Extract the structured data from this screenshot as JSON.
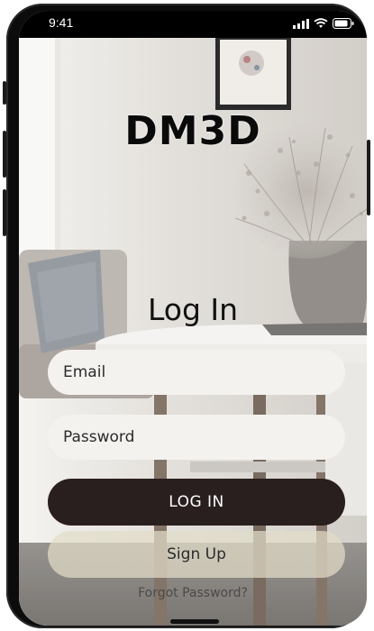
{
  "status_bar": {
    "time": "9:41",
    "signal_icon": "cellular-signal-icon",
    "wifi_icon": "wifi-icon",
    "battery_icon": "battery-icon"
  },
  "brand": {
    "logo_text": "DM3D"
  },
  "login": {
    "title": "Log In",
    "email_placeholder": "Email",
    "email_value": "",
    "password_placeholder": "Password",
    "password_value": "",
    "login_button": "LOG IN",
    "signup_button": "Sign Up",
    "forgot_password": "Forgot Password?"
  },
  "colors": {
    "login_button_bg": "#2a1f1f",
    "field_bg": "#f4f2ef",
    "signup_button_bg": "#e2dcc8"
  },
  "background": {
    "photo": "interior-room-photo"
  }
}
